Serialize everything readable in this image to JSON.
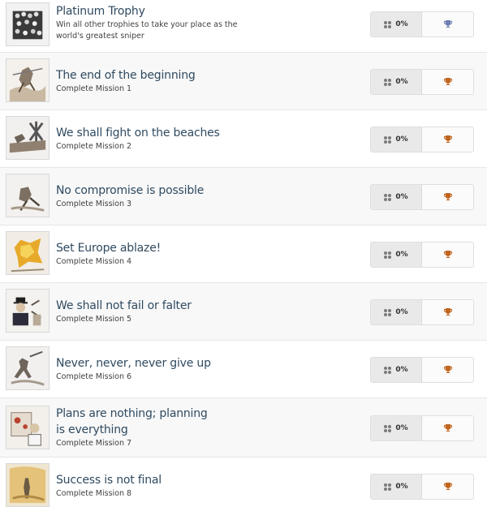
{
  "colors": {
    "platinum": "#6b7fb3",
    "bronze": "#c0651f",
    "title": "#2f4a60"
  },
  "trophies": [
    {
      "title": "Platinum Trophy",
      "description": "Win all other trophies to take your place as the world's greatest sniper",
      "percent": "0%",
      "grade": "platinum",
      "trophy_icon": "trophy-icon"
    },
    {
      "title": "The end of the beginning",
      "description": "Complete Mission 1",
      "percent": "0%",
      "grade": "bronze",
      "trophy_icon": "trophy-icon"
    },
    {
      "title": "We shall fight on the beaches",
      "description": "Complete Mission 2",
      "percent": "0%",
      "grade": "bronze",
      "trophy_icon": "trophy-icon"
    },
    {
      "title": "No compromise is possible",
      "description": "Complete Mission 3",
      "percent": "0%",
      "grade": "bronze",
      "trophy_icon": "trophy-icon"
    },
    {
      "title": "Set Europe ablaze!",
      "description": "Complete Mission 4",
      "percent": "0%",
      "grade": "bronze",
      "trophy_icon": "trophy-icon"
    },
    {
      "title": "We shall not fail or falter",
      "description": "Complete Mission 5",
      "percent": "0%",
      "grade": "bronze",
      "trophy_icon": "trophy-icon"
    },
    {
      "title": "Never, never, never give up",
      "description": "Complete Mission 6",
      "percent": "0%",
      "grade": "bronze",
      "trophy_icon": "trophy-icon"
    },
    {
      "title": "Plans are nothing; planning is everything",
      "description": "Complete Mission 7",
      "percent": "0%",
      "grade": "bronze",
      "trophy_icon": "trophy-icon"
    },
    {
      "title": "Success is not final",
      "description": "Complete Mission 8",
      "percent": "0%",
      "grade": "bronze",
      "trophy_icon": "trophy-icon"
    }
  ]
}
